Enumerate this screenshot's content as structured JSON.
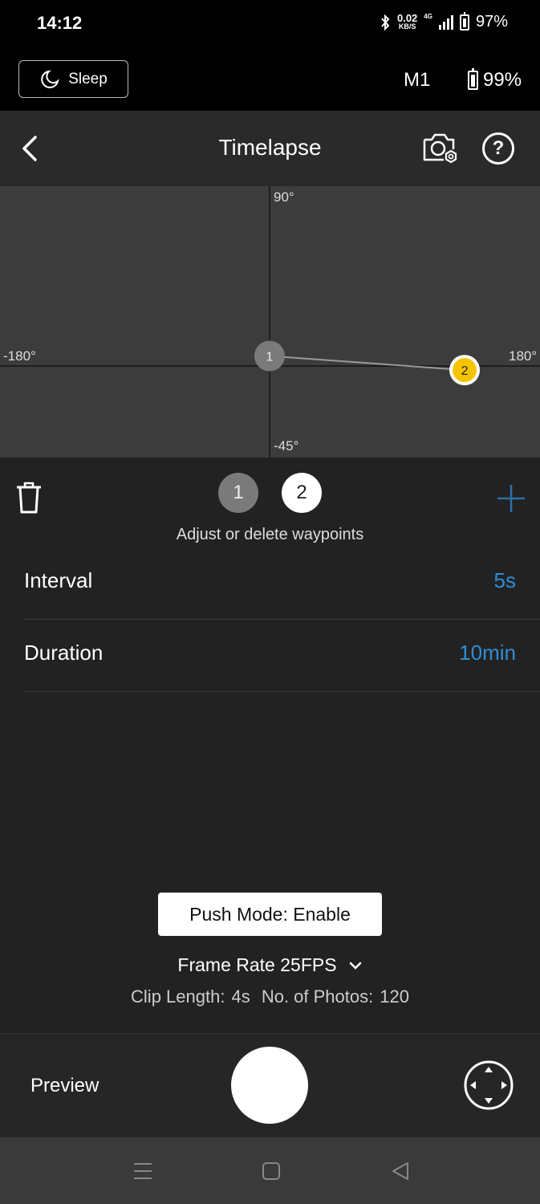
{
  "status_bar": {
    "time": "14:12",
    "net_speed_value": "0.02",
    "net_speed_unit": "KB/S",
    "network_type": "4G",
    "battery": "97%"
  },
  "device_bar": {
    "sleep_label": "Sleep",
    "device_name": "M1",
    "battery": "99%"
  },
  "header": {
    "title": "Timelapse"
  },
  "graph": {
    "top_label": "90°",
    "bottom_label": "-45°",
    "left_label": "-180°",
    "right_label": "180°",
    "waypoints": [
      {
        "label": "1",
        "pan": 0,
        "tilt": 5
      },
      {
        "label": "2",
        "pan": 130,
        "tilt": -2
      }
    ],
    "pan_range": [
      -180,
      180
    ],
    "tilt_range": [
      -45,
      90
    ]
  },
  "waypoints_panel": {
    "items": [
      {
        "label": "1"
      },
      {
        "label": "2"
      }
    ],
    "selected": "2",
    "hint": "Adjust or delete waypoints"
  },
  "settings": {
    "interval_label": "Interval",
    "interval_value": "5s",
    "duration_label": "Duration",
    "duration_value": "10min"
  },
  "push_mode": "Push Mode: Enable",
  "frame_rate": "Frame Rate 25FPS",
  "clip_info": {
    "clip_length_label": "Clip Length:",
    "clip_length_value": "4s",
    "photos_label": "No. of Photos:",
    "photos_value": "120"
  },
  "bottom": {
    "preview_label": "Preview"
  },
  "colors": {
    "accent_blue": "#2f8ed8",
    "waypoint_active": "#f5c400",
    "waypoint_inactive": "#7a7a7a"
  }
}
